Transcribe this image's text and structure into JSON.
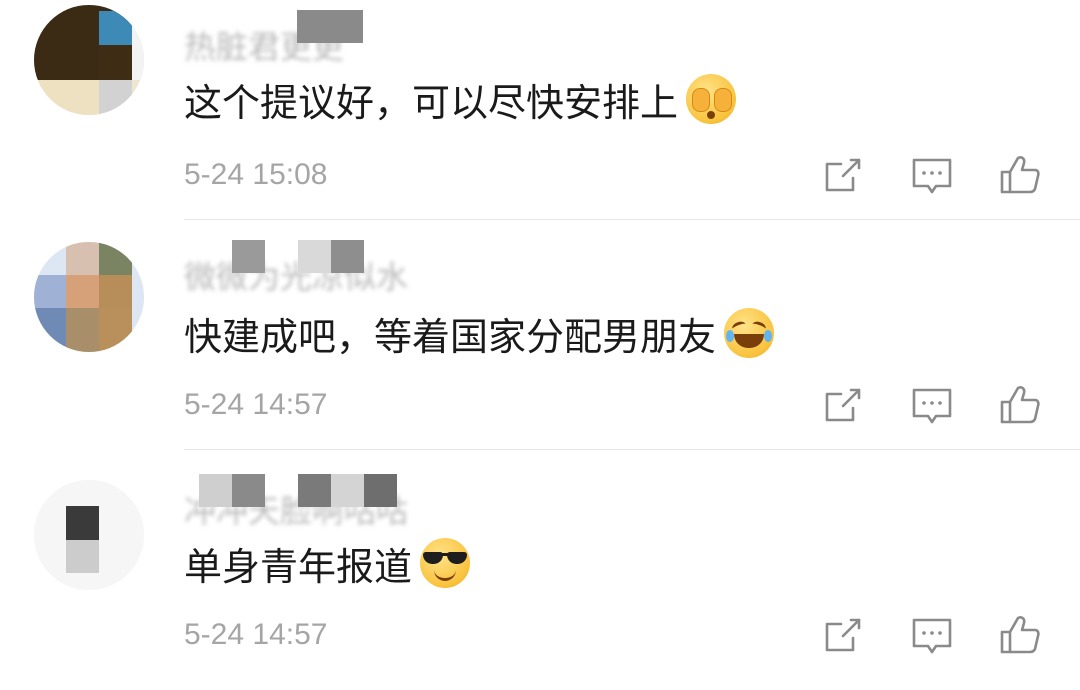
{
  "comments": [
    {
      "username": "热脏君更更",
      "text": "这个提议好，可以尽快安排上",
      "emoji": "see-no-evil-emoji",
      "time": "5-24 15:08"
    },
    {
      "username": "微微为光凉似水",
      "text": "快建成吧，等着国家分配男朋友",
      "emoji": "rolling-laughing-emoji",
      "time": "5-24 14:57"
    },
    {
      "username": "冲冲天脸啊咕咕",
      "text": "单身青年报道",
      "emoji": "sunglasses-emoji",
      "time": "5-24 14:57"
    }
  ],
  "icons": {
    "share": "share-icon",
    "reply": "comment-icon",
    "like": "thumbs-up-icon"
  },
  "colors": {
    "text": "#1a1a1a",
    "meta": "#a5a5a5",
    "icon": "#8a8a8a",
    "divider": "#e6e6e6",
    "emoji": "#f9c23c"
  }
}
